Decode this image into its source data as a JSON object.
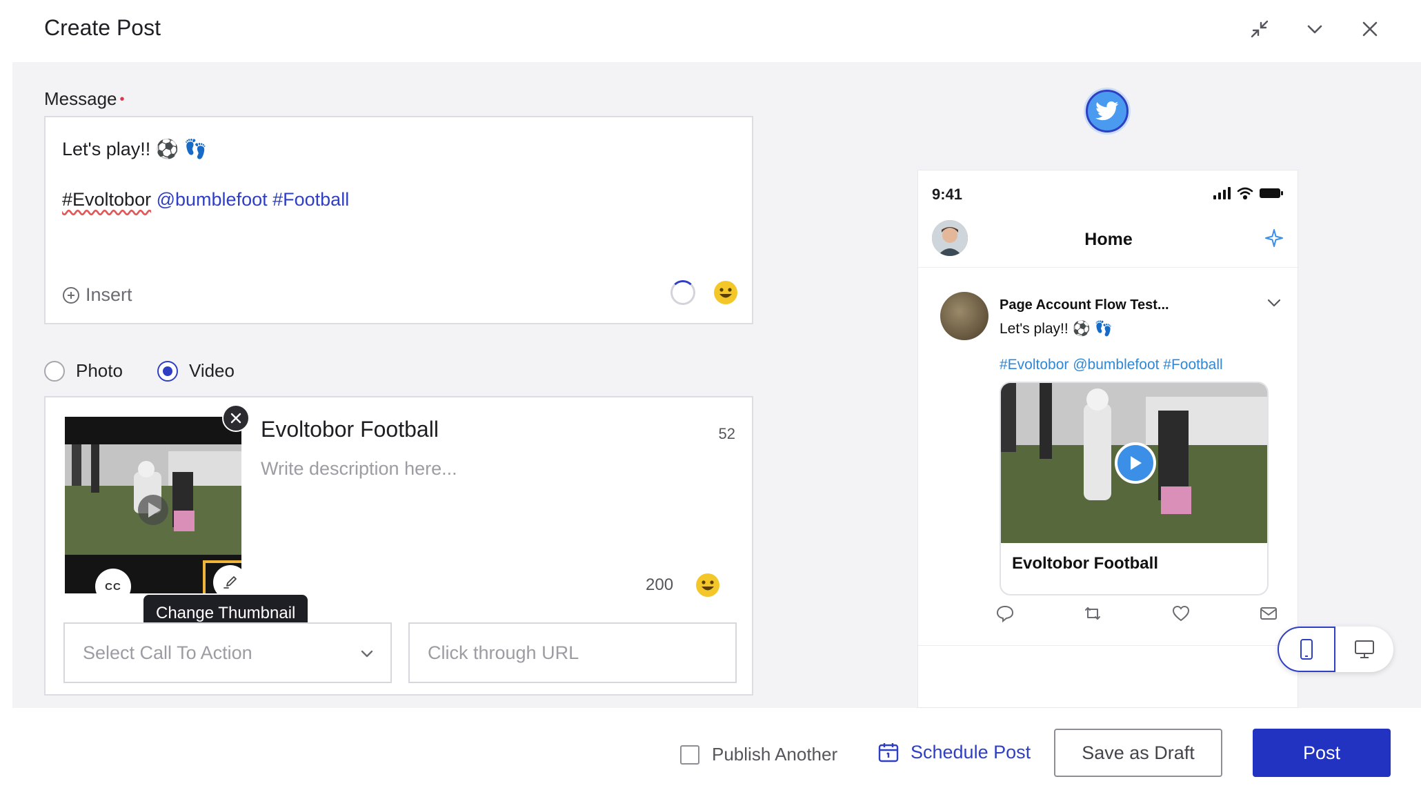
{
  "header": {
    "title": "Create Post",
    "icons": [
      "minimize-icon",
      "chevron-down-icon",
      "close-icon"
    ]
  },
  "composer": {
    "message_label": "Message",
    "required_mark": "•",
    "message_line1": "Let's play!! ⚽ 👣",
    "message_tag_misspelled": "#Evoltobor",
    "message_mention": "@bumblefoot",
    "message_hashtag": "#Football",
    "insert_label": "Insert"
  },
  "media_type": {
    "options": [
      "Photo",
      "Video"
    ],
    "selected": "Video"
  },
  "media": {
    "cc_label": "CC",
    "tooltip": "Change Thumbnail",
    "video_title": "Evoltobor Football",
    "title_count": "52",
    "description_placeholder": "Write description here...",
    "description_count": "200",
    "cta_placeholder": "Select Call To Action",
    "url_placeholder": "Click through URL"
  },
  "preview": {
    "network": "twitter-icon",
    "status_time": "9:41",
    "home_title": "Home",
    "account_name": "Page Account Flow Test...",
    "tweet_text": "Let's play!! ⚽ 👣",
    "tweet_tags": "#Evoltobor @bumblefoot #Football",
    "card_title": "Evoltobor Football",
    "device_selected": "mobile"
  },
  "footer": {
    "publish_another_label": "Publish Another",
    "publish_another_checked": false,
    "schedule_label": "Schedule Post",
    "draft_label": "Save as Draft",
    "post_label": "Post"
  },
  "colors": {
    "accent": "#2f3fc4",
    "primary_button": "#2233c2",
    "twitter": "#4a9bef",
    "highlight": "#f0b43a",
    "panel_bg": "#f3f3f6"
  }
}
